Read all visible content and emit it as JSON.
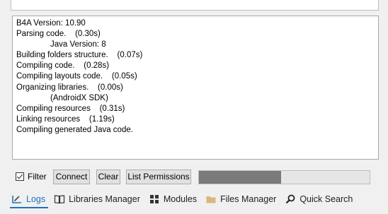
{
  "log": {
    "lines": [
      "B4A Version: 10.90",
      "Parsing code.    (0.30s)",
      "Java Version: 8",
      "Building folders structure.    (0.07s)",
      "Compiling code.    (0.28s)",
      "Compiling layouts code.    (0.05s)",
      "Organizing libraries.    (0.00s)",
      "(AndroidX SDK)",
      "Compiling resources    (0.31s)",
      "Linking resources    (1.19s)",
      "Compiling generated Java code."
    ]
  },
  "toolbar": {
    "filter_label": "Filter",
    "filter_checked": true,
    "connect_label": "Connect",
    "clear_label": "Clear",
    "permissions_label": "List Permissions",
    "progress_fraction": 0.48
  },
  "tabs": [
    {
      "label": "Logs",
      "icon": "logs-icon",
      "active": true
    },
    {
      "label": "Libraries Manager",
      "icon": "book-icon",
      "active": false
    },
    {
      "label": "Modules",
      "icon": "modules-icon",
      "active": false
    },
    {
      "label": "Files Manager",
      "icon": "folder-icon",
      "active": false
    },
    {
      "label": "Quick Search",
      "icon": "search-icon",
      "active": false
    }
  ],
  "colors": {
    "accent": "#1e73be",
    "progress_fill": "#7a7a7a",
    "folder": "#dcb67a"
  }
}
